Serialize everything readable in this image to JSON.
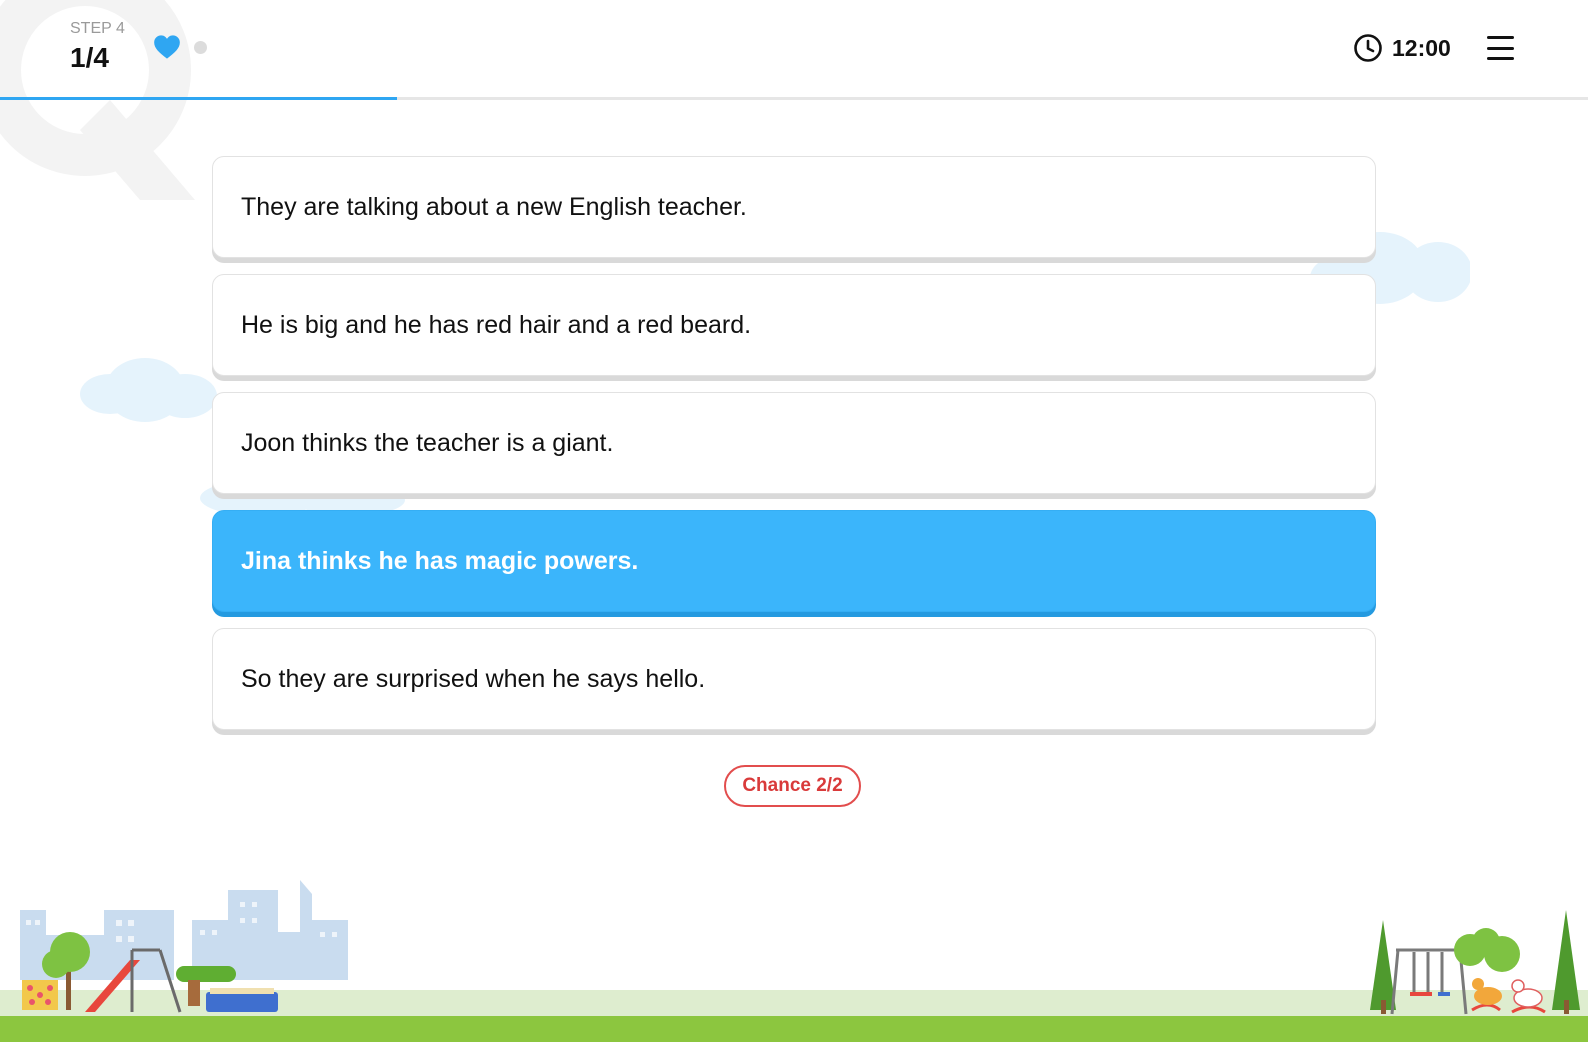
{
  "header": {
    "step_label": "STEP 4",
    "step_count": "1/4",
    "timer": "12:00",
    "progress_fraction": 0.25
  },
  "options": [
    {
      "text": "They are talking about a new English teacher.",
      "selected": false
    },
    {
      "text": "He is big and he has red hair and a red beard.",
      "selected": false
    },
    {
      "text": "Joon thinks the teacher is a giant.",
      "selected": false
    },
    {
      "text": "Jina thinks he has magic powers.",
      "selected": true
    },
    {
      "text": "So they are surprised when he says hello.",
      "selected": false
    }
  ],
  "chance": "Chance 2/2",
  "icons": {
    "heart": "heart-icon",
    "timer": "clock-icon",
    "menu": "hamburger-menu-icon"
  },
  "colors": {
    "accent": "#3bb5fb",
    "heart": "#2fa6f2",
    "chance": "#d93a3a",
    "grass": "#8cc63f"
  }
}
